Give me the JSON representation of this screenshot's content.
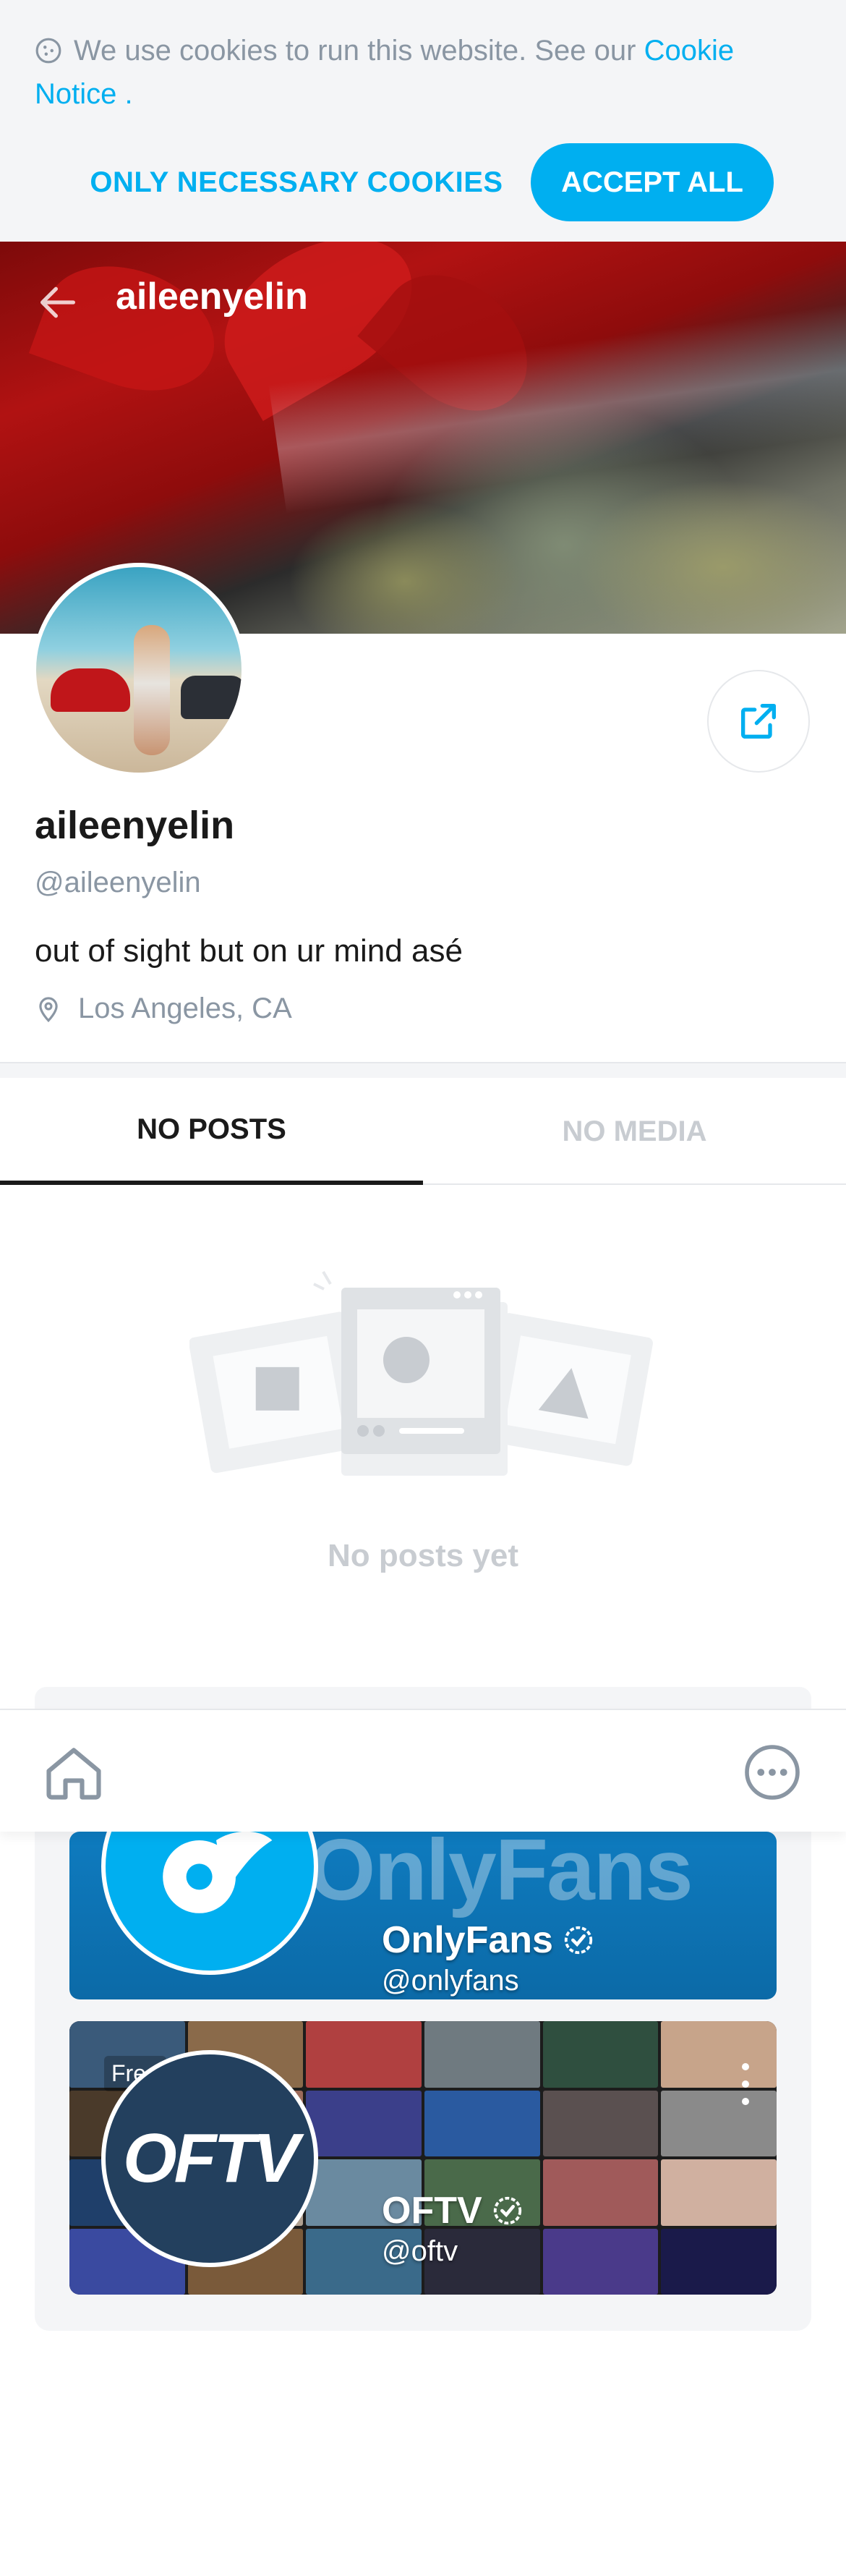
{
  "cookie_banner": {
    "text": "We use cookies to run this website. See our",
    "link_text": "Cookie Notice",
    "suffix": ".",
    "necessary_label": "ONLY NECESSARY COOKIES",
    "accept_label": "ACCEPT ALL"
  },
  "header": {
    "title": "aileenyelin"
  },
  "profile": {
    "name": "aileenyelin",
    "handle": "@aileenyelin",
    "bio": "out of sight but on ur mind asé",
    "location": "Los Angeles, CA"
  },
  "tabs": [
    {
      "label": "NO POSTS",
      "active": true
    },
    {
      "label": "NO MEDIA",
      "active": false
    }
  ],
  "empty_state": {
    "text": "No posts yet"
  },
  "suggestions": [
    {
      "name": "OnlyFans",
      "handle": "@onlyfans",
      "watermark": "OnlyFans",
      "verified": true
    },
    {
      "name": "OFTV",
      "handle": "@oftv",
      "badge": "Free",
      "logo": "OFTV",
      "verified": true
    }
  ],
  "colors": {
    "accent": "#00aff0",
    "muted": "#8a96a3",
    "text": "#1a1a1a",
    "bg_light": "#f4f5f7"
  },
  "icons": {
    "cookie": "cookie-icon",
    "back": "back-arrow-icon",
    "share": "share-icon",
    "location": "location-pin-icon",
    "home": "home-icon",
    "more": "more-icon",
    "verified": "verified-icon"
  }
}
